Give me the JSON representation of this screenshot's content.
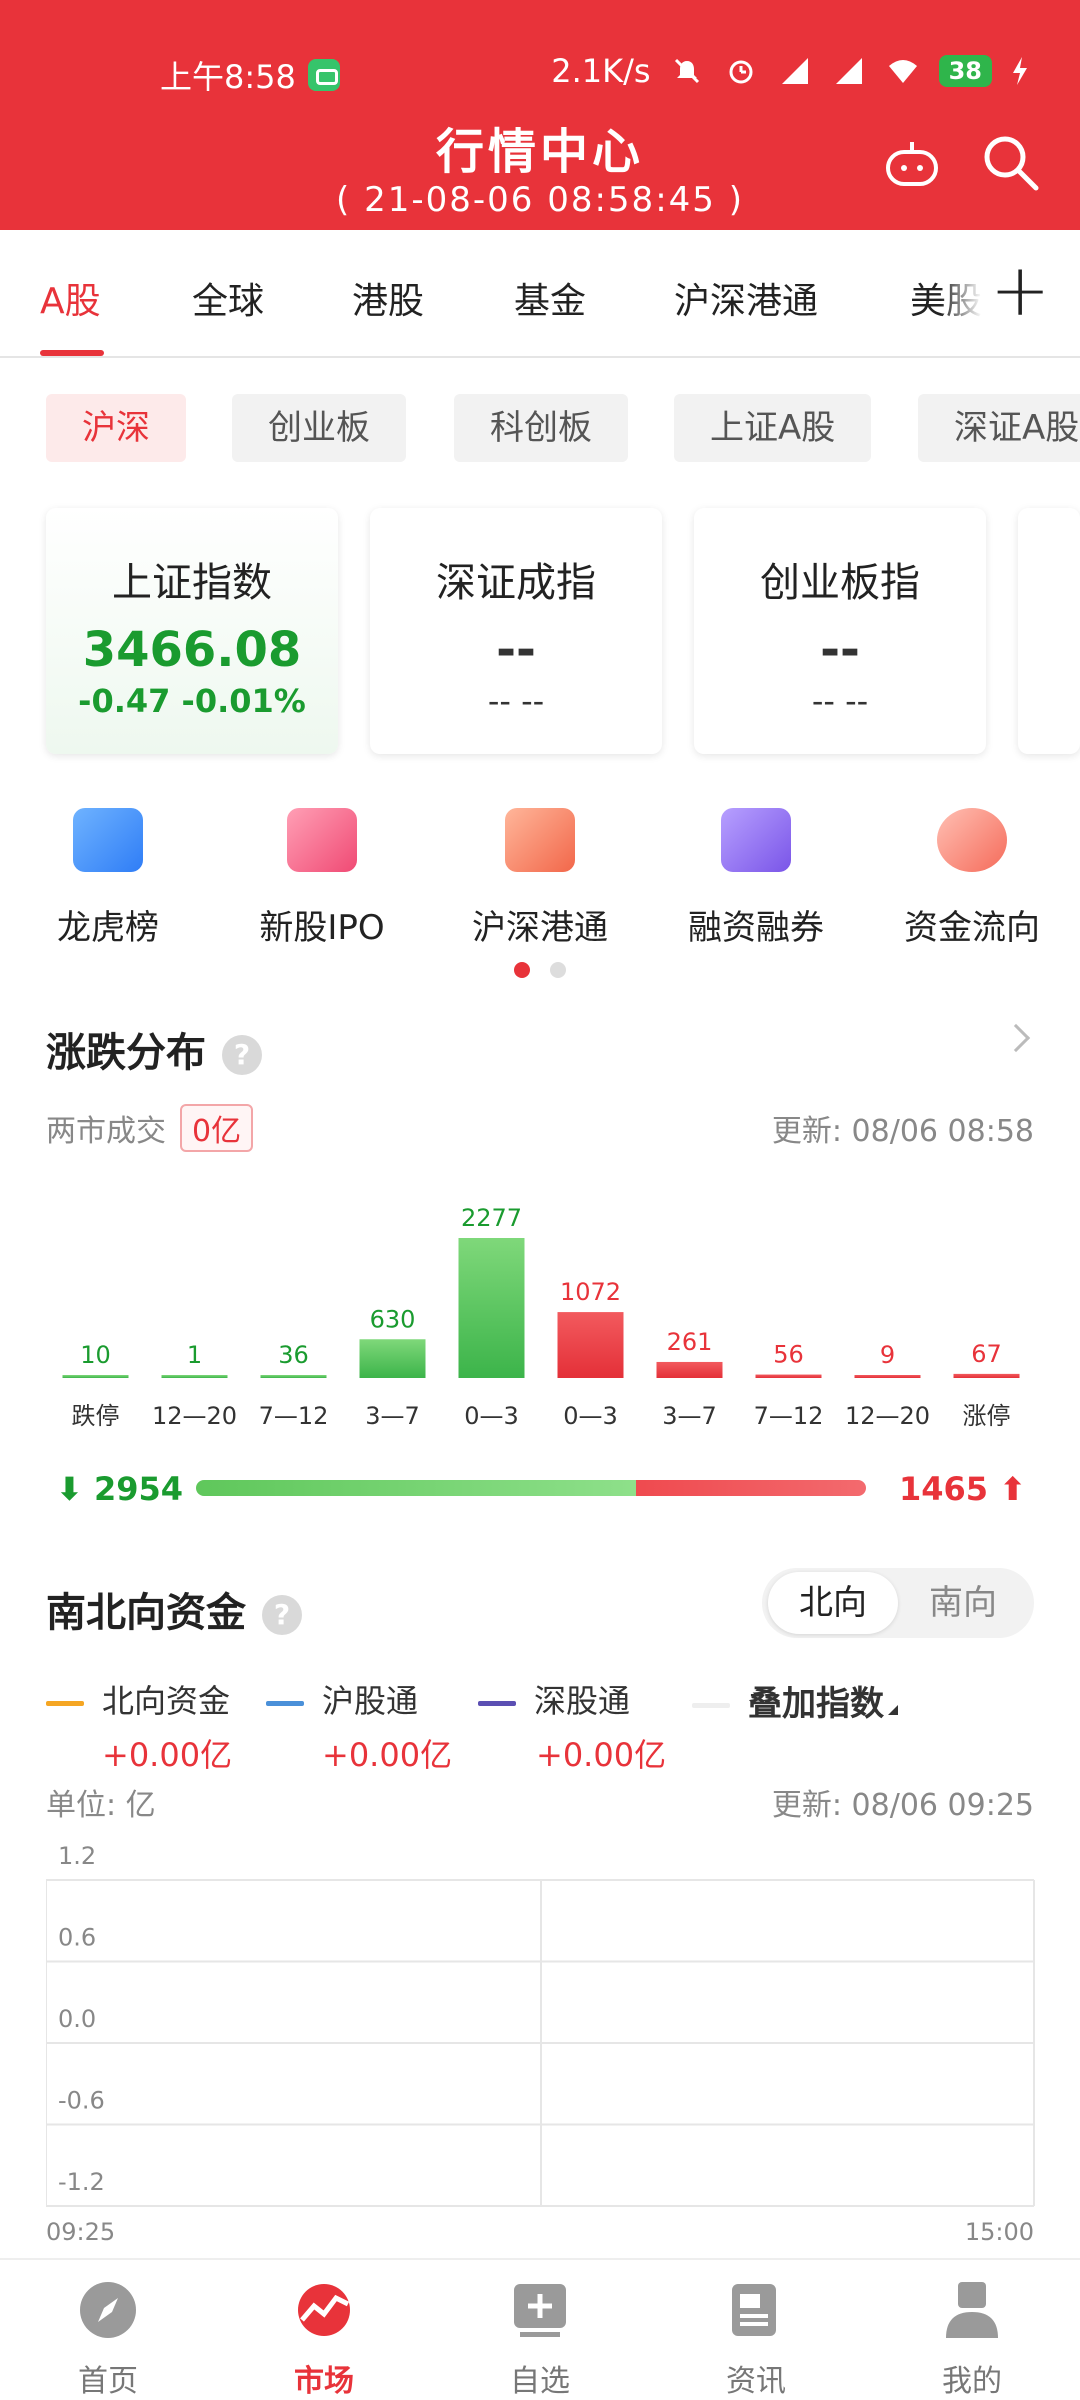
{
  "status": {
    "time": "上午8:58",
    "net": "2.1K/s",
    "battery": "38"
  },
  "header": {
    "title": "行情中心",
    "subtitle": "( 21-08-06  08:58:45 )"
  },
  "tabs": [
    "A股",
    "全球",
    "港股",
    "基金",
    "沪深港通",
    "美股"
  ],
  "chips": [
    "沪深",
    "创业板",
    "科创板",
    "上证A股",
    "深证A股"
  ],
  "indices": [
    {
      "name": "上证指数",
      "value": "3466.08",
      "change": "-0.47  -0.01%"
    },
    {
      "name": "深证成指",
      "value": "--",
      "change": "-- --"
    },
    {
      "name": "创业板指",
      "value": "--",
      "change": "-- --"
    }
  ],
  "quick": [
    "龙虎榜",
    "新股IPO",
    "沪深港通",
    "融资融券",
    "资金流向"
  ],
  "dist": {
    "title": "涨跌分布",
    "help": "?",
    "turnover_label": "两市成交",
    "turnover_value": "0亿",
    "updated": "更新: 08/06 08:58",
    "down_count": "2954",
    "up_count": "1465"
  },
  "chart_data": [
    {
      "type": "bar",
      "categories": [
        "跌停",
        "12—20",
        "7—12",
        "3—7",
        "0—3",
        "0—3",
        "3—7",
        "7—12",
        "12—20",
        "涨停"
      ],
      "values": [
        10,
        1,
        36,
        630,
        2277,
        1072,
        261,
        56,
        9,
        67
      ],
      "colors": [
        "#1a9b2f",
        "#1a9b2f",
        "#1a9b2f",
        "#1a9b2f",
        "#1a9b2f",
        "#e8333a",
        "#e8333a",
        "#e8333a",
        "#e8333a",
        "#e8333a"
      ]
    },
    {
      "type": "line",
      "ylim": [
        -1.2,
        1.2
      ],
      "yticks": [
        "1.2",
        "0.6",
        "0.0",
        "-0.6",
        "-1.2"
      ],
      "xticks": [
        "09:25",
        "15:00"
      ],
      "series": []
    }
  ],
  "flow": {
    "title": "南北向资金",
    "help": "?",
    "toggle_on": "北向",
    "toggle_off": "南向",
    "legend": [
      {
        "label": "北向资金",
        "value": "+0.00亿",
        "color": "#f5a623"
      },
      {
        "label": "沪股通",
        "value": "+0.00亿",
        "color": "#4a90d9"
      },
      {
        "label": "深股通",
        "value": "+0.00亿",
        "color": "#5b4fb3"
      },
      {
        "label": "叠加指数",
        "value": "",
        "color": "#eeeeee"
      }
    ],
    "unit": "单位: 亿",
    "updated": "更新: 08/06 09:25"
  },
  "nav": [
    "首页",
    "市场",
    "自选",
    "资讯",
    "我的"
  ]
}
